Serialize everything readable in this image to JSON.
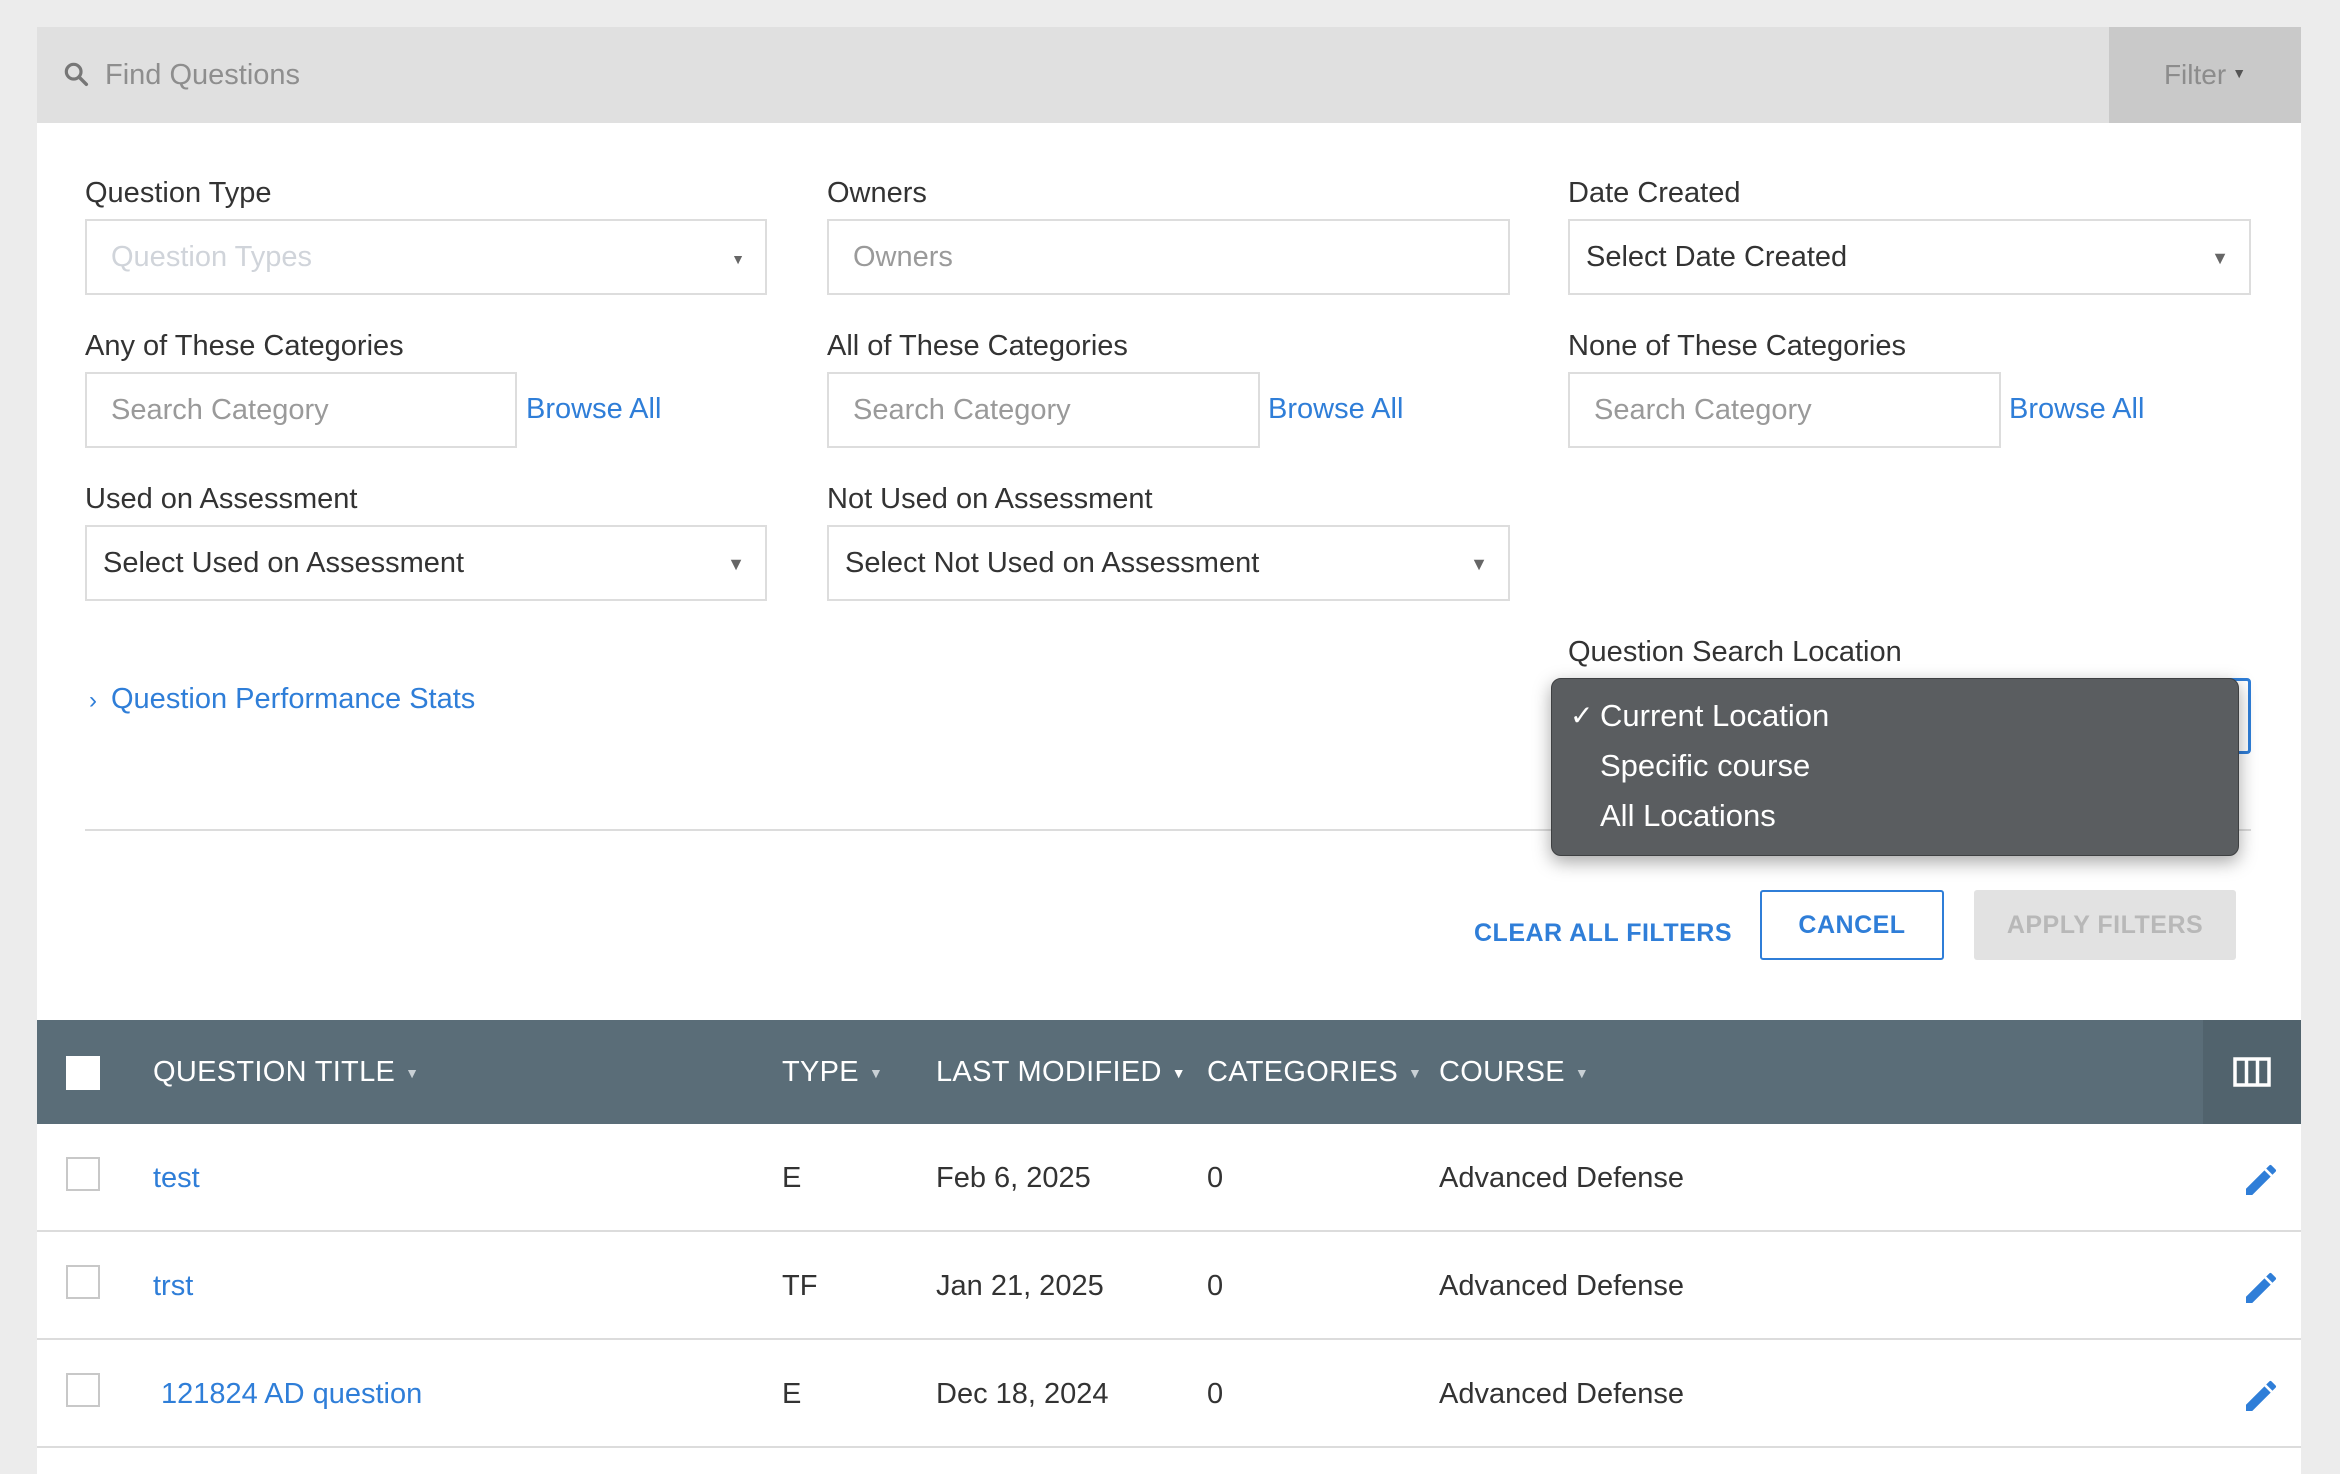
{
  "search": {
    "placeholder": "Find Questions",
    "filter_label": "Filter"
  },
  "filters": {
    "question_type": {
      "label": "Question Type",
      "placeholder": "Question Types"
    },
    "owners": {
      "label": "Owners",
      "placeholder": "Owners"
    },
    "date_created": {
      "label": "Date Created",
      "value": "Select Date Created"
    },
    "any_categories": {
      "label": "Any of These Categories",
      "placeholder": "Search Category",
      "browse": "Browse All"
    },
    "all_categories": {
      "label": "All of These Categories",
      "placeholder": "Search Category",
      "browse": "Browse All"
    },
    "none_categories": {
      "label": "None of These Categories",
      "placeholder": "Search Category",
      "browse": "Browse All"
    },
    "used_on": {
      "label": "Used on Assessment",
      "value": "Select Used on Assessment"
    },
    "not_used_on": {
      "label": "Not Used on Assessment",
      "value": "Select Not Used on Assessment"
    },
    "search_location": {
      "label": "Question Search Location",
      "options": [
        "Current Location",
        "Specific course",
        "All Locations"
      ],
      "selected_index": 0
    },
    "performance_stats": "Question Performance Stats"
  },
  "actions": {
    "clear": "CLEAR ALL FILTERS",
    "cancel": "CANCEL",
    "apply": "APPLY FILTERS"
  },
  "table": {
    "columns": [
      "QUESTION TITLE",
      "TYPE",
      "LAST MODIFIED",
      "CATEGORIES",
      "COURSE"
    ],
    "rows": [
      {
        "title": "test",
        "type": "E",
        "modified": "Feb 6, 2025",
        "categories": "0",
        "course": "Advanced Defense"
      },
      {
        "title": "trst",
        "type": "TF",
        "modified": "Jan 21, 2025",
        "categories": "0",
        "course": "Advanced Defense"
      },
      {
        "title": "121824 AD question",
        "type": "E",
        "modified": "Dec 18, 2024",
        "categories": "0",
        "course": "Advanced Defense"
      }
    ]
  },
  "colors": {
    "accent": "#2f7ed8",
    "header": "#5a6d78",
    "menu": "#5a5d60"
  }
}
